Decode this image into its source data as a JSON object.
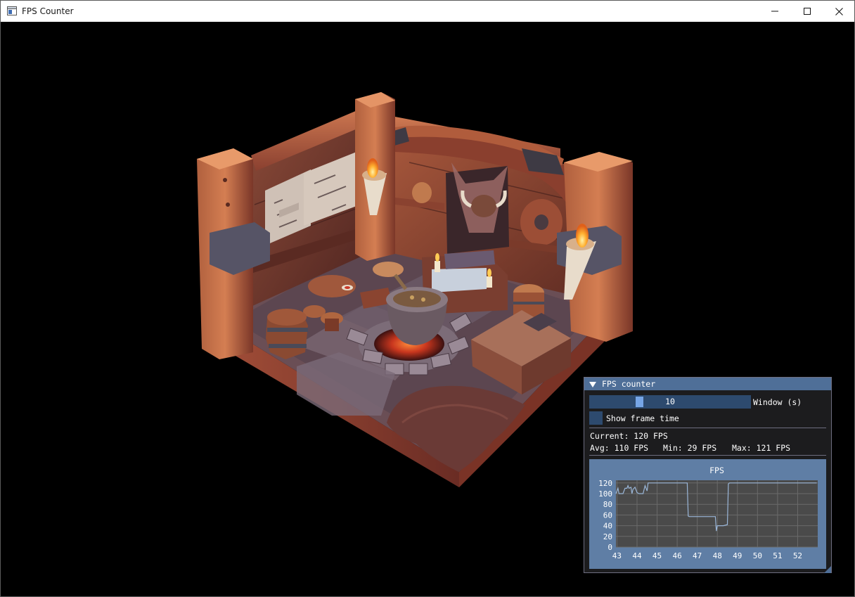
{
  "window": {
    "title": "FPS Counter"
  },
  "panel": {
    "title": "FPS counter",
    "slider": {
      "value": "10",
      "label": "Window (s)",
      "fraction": 0.3
    },
    "checkbox": {
      "label": "Show frame time",
      "checked": false
    },
    "stats": {
      "current": "Current: 120 FPS",
      "avg": "Avg: 110 FPS",
      "min": "Min: 29 FPS",
      "max": "Max: 121 FPS"
    }
  },
  "colors": {
    "accent": "#4f6f98",
    "plot_bg": "#5f7ea5",
    "plot_area": "#4a4a4a",
    "line": "#9ab6d8",
    "slider_bg": "#2d4a6e",
    "grab": "#76a5e6"
  },
  "chart_data": {
    "type": "line",
    "title": "FPS",
    "xlabel": "",
    "ylabel": "",
    "xlim": [
      42.95,
      53.0
    ],
    "ylim": [
      0,
      125
    ],
    "x_ticks": [
      "43",
      "44",
      "45",
      "46",
      "47",
      "48",
      "49",
      "50",
      "51",
      "52"
    ],
    "y_ticks": [
      "0",
      "20",
      "40",
      "60",
      "80",
      "100",
      "120"
    ],
    "grid": true,
    "series": [
      {
        "x": [
          42.95,
          43.05,
          43.1,
          43.2,
          43.3,
          43.4,
          43.5,
          43.55,
          43.6,
          43.7,
          43.75,
          43.8,
          43.9,
          44.0,
          44.1,
          44.2,
          44.3,
          44.4,
          44.5,
          44.55,
          44.6,
          46.5,
          46.55,
          46.6,
          47.9,
          47.95,
          48.0,
          48.05,
          48.15,
          48.2,
          48.25,
          48.3,
          48.5,
          48.55,
          48.6,
          48.7,
          49.0,
          50.0,
          51.0,
          52.0,
          52.95
        ],
        "y": [
          100,
          110,
          100,
          100,
          100,
          110,
          110,
          115,
          110,
          112,
          100,
          108,
          112,
          102,
          100,
          100,
          100,
          115,
          105,
          120,
          120,
          120,
          58,
          57,
          57,
          30,
          40,
          40,
          40,
          40,
          40,
          40,
          42,
          118,
          120,
          120,
          120,
          120,
          120,
          120,
          120
        ]
      }
    ]
  }
}
